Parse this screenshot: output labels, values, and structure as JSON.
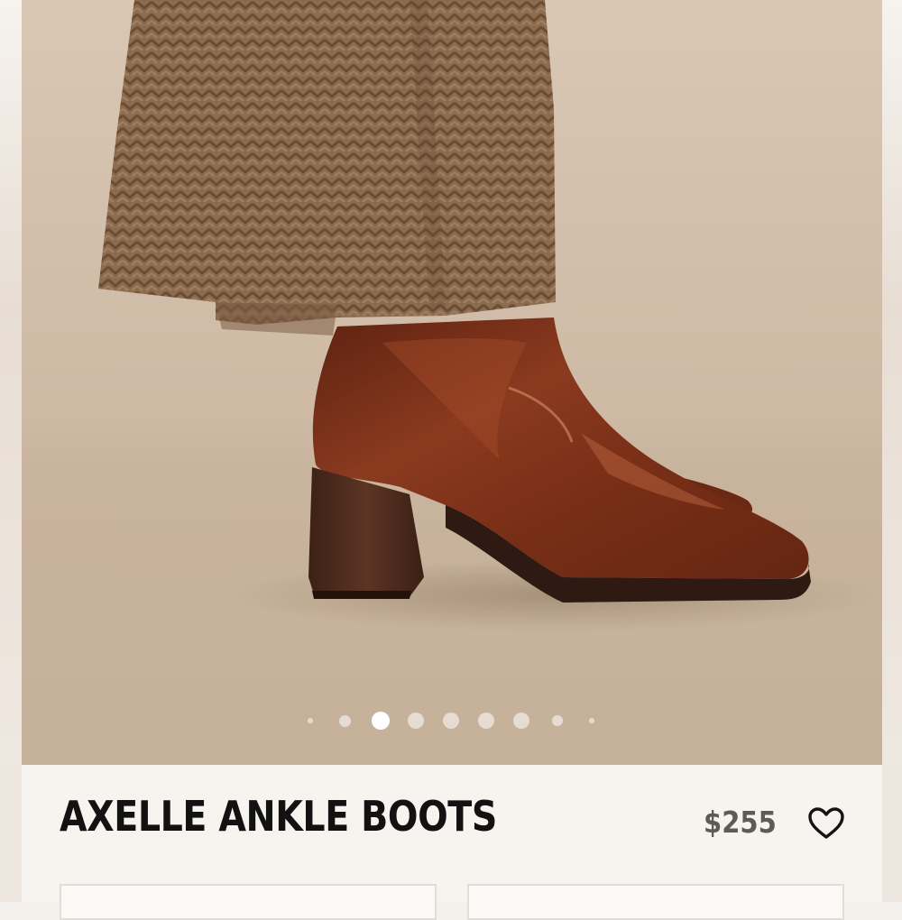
{
  "product": {
    "title": "AXELLE ANKLE BOOTS",
    "price": "$255"
  },
  "gallery": {
    "image_count": 9,
    "active_index": 2
  },
  "icons": {
    "wishlist": "heart-outline-icon"
  },
  "colors": {
    "title_text": "#121212",
    "price_text": "#5e5a57",
    "boot_leather": "#7a2f17",
    "trousers": "#8a6a4e",
    "backdrop": "#cdb8a3"
  }
}
